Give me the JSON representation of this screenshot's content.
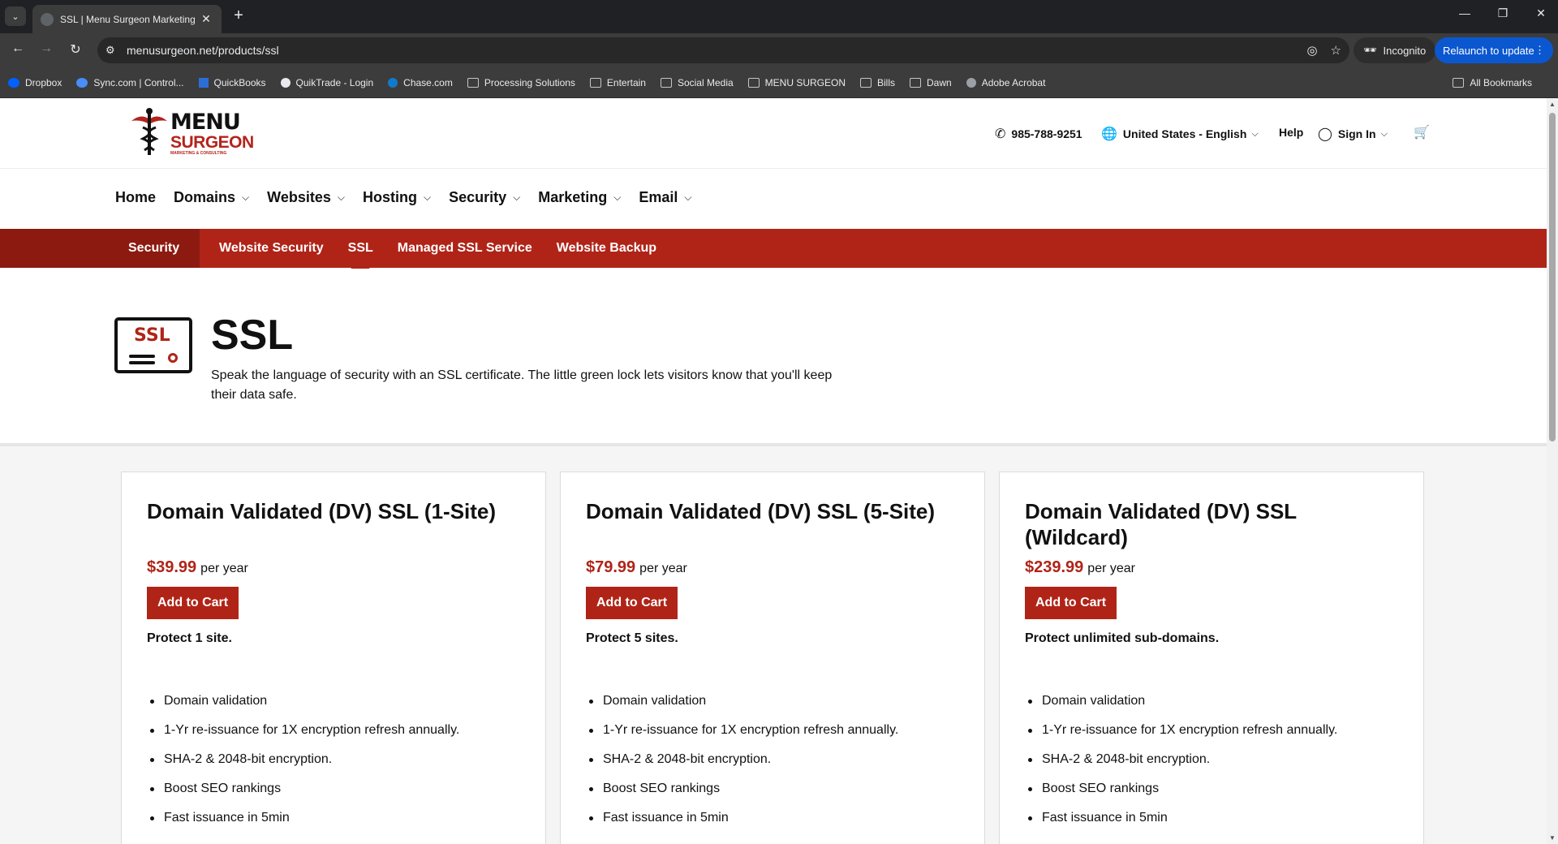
{
  "browser": {
    "tab_title": "SSL | Menu Surgeon Marketing",
    "url": "menusurgeon.net/products/ssl",
    "incognito_label": "Incognito",
    "relaunch_label": "Relaunch to update",
    "bookmarks": [
      {
        "label": "Dropbox",
        "icon": "dropbox-icon",
        "color": "#0061fe"
      },
      {
        "label": "Sync.com | Control...",
        "icon": "sync-icon",
        "color": "#4a8df8"
      },
      {
        "label": "QuickBooks",
        "icon": "quickbooks-icon",
        "color": "#2b6fd6"
      },
      {
        "label": "QuikTrade - Login",
        "icon": "quiktrade-icon",
        "color": "#e8eaed"
      },
      {
        "label": "Chase.com",
        "icon": "chase-icon",
        "color": "#117aca"
      },
      {
        "label": "Processing Solutions",
        "icon": "folder-icon"
      },
      {
        "label": "Entertain",
        "icon": "folder-icon"
      },
      {
        "label": "Social Media",
        "icon": "folder-icon"
      },
      {
        "label": "MENU SURGEON",
        "icon": "folder-icon"
      },
      {
        "label": "Bills",
        "icon": "folder-icon"
      },
      {
        "label": "Dawn",
        "icon": "folder-icon"
      },
      {
        "label": "Adobe Acrobat",
        "icon": "globe-icon",
        "color": "#9aa0a6"
      }
    ],
    "all_bookmarks_label": "All Bookmarks"
  },
  "site": {
    "logo": {
      "word1": "MENU",
      "word2": "SURGEON",
      "tagline": "MARKETING & CONSULTING"
    },
    "phone": "985-788-9251",
    "locale": "United States - English",
    "help": "Help",
    "sign_in": "Sign In",
    "nav": [
      "Home",
      "Domains",
      "Websites",
      "Hosting",
      "Security",
      "Marketing",
      "Email"
    ],
    "subnav": {
      "category": "Security",
      "links": [
        "Website Security",
        "SSL",
        "Managed SSL Service",
        "Website Backup"
      ]
    },
    "hero": {
      "icon_text": "SSL",
      "title": "SSL",
      "description": "Speak the language of security with an SSL certificate. The little green lock lets visitors know that you'll keep their data safe."
    },
    "plans": [
      {
        "title": "Domain Validated (DV) SSL (1-Site)",
        "price": "$39.99",
        "unit": "per year",
        "button": "Add to Cart",
        "lead": "Protect 1 site.",
        "features": [
          "Domain validation",
          "1-Yr re-issuance for 1X encryption refresh annually.",
          "SHA-2 & 2048-bit encryption.",
          "Boost SEO rankings",
          "Fast issuance in 5min"
        ]
      },
      {
        "title": "Domain Validated (DV) SSL (5-Site)",
        "price": "$79.99",
        "unit": "per year",
        "button": "Add to Cart",
        "lead": "Protect 5 sites.",
        "features": [
          "Domain validation",
          "1-Yr re-issuance for 1X encryption refresh annually.",
          "SHA-2 & 2048-bit encryption.",
          "Boost SEO rankings",
          "Fast issuance in 5min"
        ]
      },
      {
        "title": "Domain Validated (DV) SSL (Wildcard)",
        "price": "$239.99",
        "unit": "per year",
        "button": "Add to Cart",
        "lead": "Protect unlimited sub-domains.",
        "features": [
          "Domain validation",
          "1-Yr re-issuance for 1X encryption refresh annually.",
          "SHA-2 & 2048-bit encryption.",
          "Boost SEO rankings",
          "Fast issuance in 5min"
        ]
      }
    ]
  },
  "colors": {
    "brand_red": "#b02418",
    "brand_dark_red": "#8d1a10",
    "chrome_dark": "#202124"
  }
}
